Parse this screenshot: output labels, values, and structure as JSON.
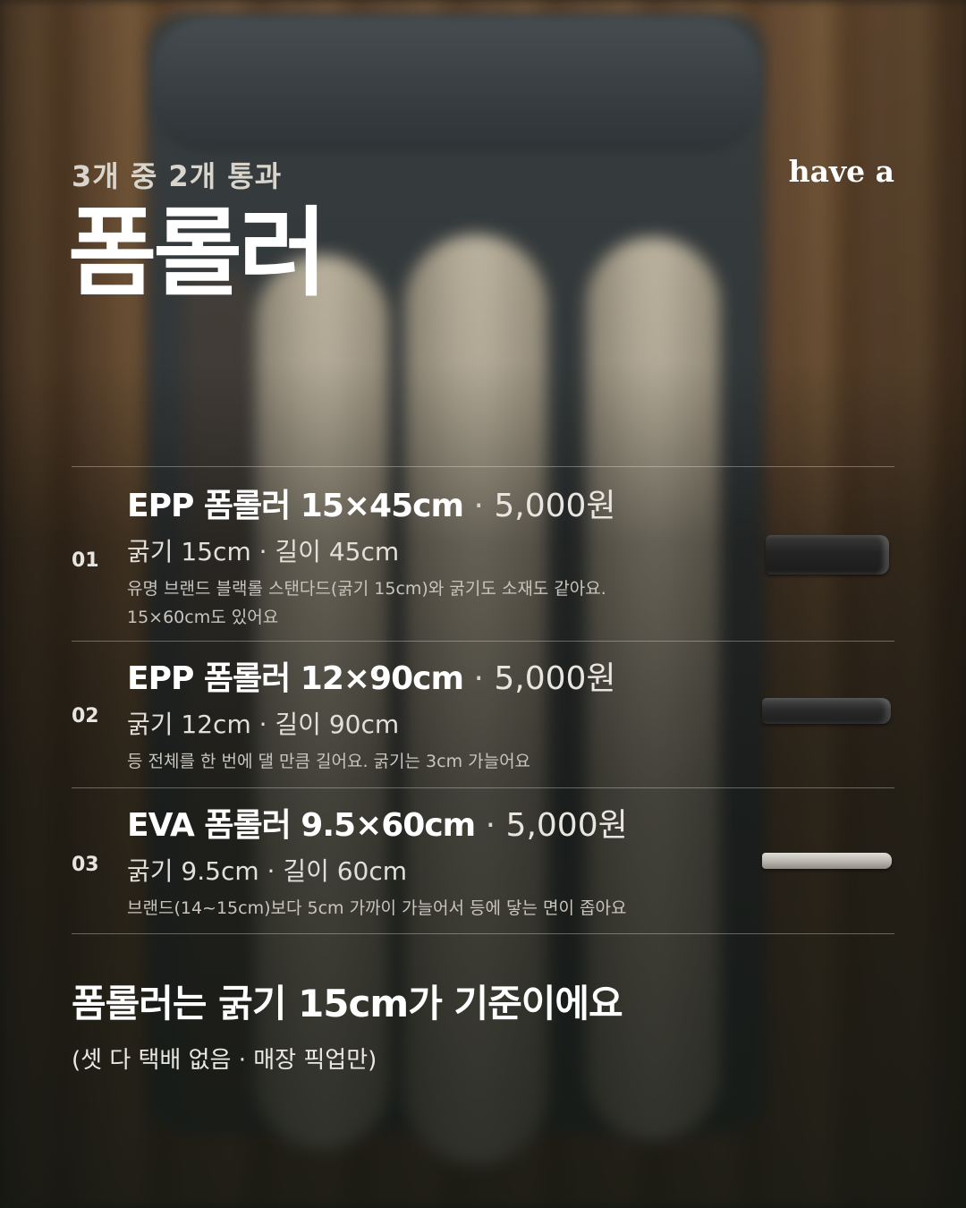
{
  "header": {
    "subtitle": "3개 중 2개 통과",
    "brand": "have a",
    "title": "폼롤러"
  },
  "items": [
    {
      "number": "01",
      "name": "EPP 폼롤러 15×45cm",
      "separator": "·",
      "price": "5,000원",
      "spec": "굵기 15cm · 길이 45cm",
      "desc_lines": [
        "유명 브랜드 블랙롤 스탠다드(굵기 15cm)와 굵기도 소재도 같아요.",
        "15×60cm도 있어요"
      ],
      "thumbnail": "black-foam-roller-image"
    },
    {
      "number": "02",
      "name": "EPP 폼롤러 12×90cm",
      "separator": "·",
      "price": "5,000원",
      "spec": "굵기 12cm · 길이 90cm",
      "desc_lines": [
        "등 전체를 한 번에 댈 만큼 길어요. 굵기는 3cm 가늘어요"
      ],
      "thumbnail": "long-black-foam-roller-image"
    },
    {
      "number": "03",
      "name": "EVA 폼롤러 9.5×60cm",
      "separator": "·",
      "price": "5,000원",
      "spec": "굵기 9.5cm · 길이 60cm",
      "desc_lines": [
        "브랜드(14~15cm)보다 5cm 가까이 가늘어서 등에 닿는 면이 좁아요"
      ],
      "thumbnail": "gray-foam-roller-image"
    }
  ],
  "footer": {
    "title": "폼롤러는 굵기 15cm가 기준이에요",
    "note": "(셋 다 택배 없음 · 매장 픽업만)"
  }
}
